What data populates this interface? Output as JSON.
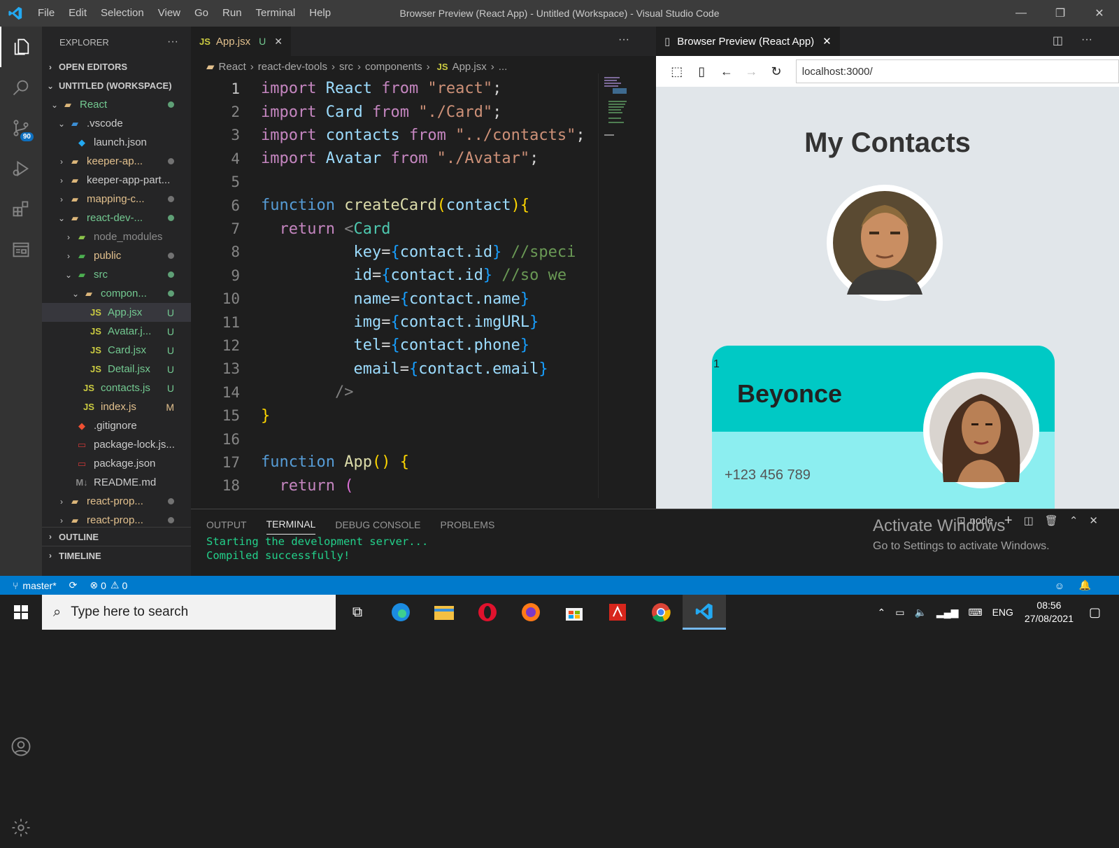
{
  "window": {
    "title": "Browser Preview (React App) - Untitled (Workspace) - Visual Studio Code",
    "menu": [
      "File",
      "Edit",
      "Selection",
      "View",
      "Go",
      "Run",
      "Terminal",
      "Help"
    ],
    "controls": {
      "minimize": "—",
      "restore": "❐",
      "close": "✕"
    }
  },
  "activity_bar": {
    "items": [
      "explorer-icon",
      "search-icon",
      "source-control-icon",
      "run-debug-icon",
      "extensions-icon",
      "browser-preview-icon"
    ],
    "source_control_badge": "90",
    "bottom": [
      "account-icon",
      "settings-gear-icon"
    ]
  },
  "sidebar": {
    "title": "EXPLORER",
    "more": "···",
    "sections": {
      "open_editors": "OPEN EDITORS",
      "workspace": "UNTITLED (WORKSPACE)",
      "outline": "OUTLINE",
      "timeline": "TIMELINE"
    },
    "tree": [
      {
        "label": "React",
        "indent": 1,
        "chev": "⌄",
        "icon": "folder",
        "color": "#73c991",
        "dot": "green"
      },
      {
        "label": ".vscode",
        "indent": 2,
        "chev": "⌄",
        "icon": "vscode-folder",
        "color": "#cccccc"
      },
      {
        "label": "launch.json",
        "indent": 3,
        "chev": "",
        "icon": "vscode-file",
        "color": "#cccccc"
      },
      {
        "label": "keeper-ap...",
        "indent": 2,
        "chev": "›",
        "icon": "folder",
        "color": "#e2c08d",
        "dot": "grey"
      },
      {
        "label": "keeper-app-part...",
        "indent": 2,
        "chev": "›",
        "icon": "folder",
        "color": "#cccccc"
      },
      {
        "label": "mapping-c...",
        "indent": 2,
        "chev": "›",
        "icon": "folder",
        "color": "#e2c08d",
        "dot": "grey"
      },
      {
        "label": "react-dev-...",
        "indent": 2,
        "chev": "⌄",
        "icon": "folder",
        "color": "#73c991",
        "dot": "green"
      },
      {
        "label": "node_modules",
        "indent": 3,
        "chev": "›",
        "icon": "node-folder",
        "color": "#8c8c8c"
      },
      {
        "label": "public",
        "indent": 3,
        "chev": "›",
        "icon": "public-folder",
        "color": "#e2c08d",
        "dot": "grey"
      },
      {
        "label": "src",
        "indent": 3,
        "chev": "⌄",
        "icon": "src-folder",
        "color": "#73c991",
        "dot": "green"
      },
      {
        "label": "compon...",
        "indent": 4,
        "chev": "⌄",
        "icon": "folder",
        "color": "#73c991",
        "dot": "green"
      },
      {
        "label": "App.jsx",
        "indent": 5,
        "chev": "",
        "icon": "js",
        "color": "#73c991",
        "mark": "U",
        "selected": true
      },
      {
        "label": "Avatar.j...",
        "indent": 5,
        "chev": "",
        "icon": "js",
        "color": "#73c991",
        "mark": "U"
      },
      {
        "label": "Card.jsx",
        "indent": 5,
        "chev": "",
        "icon": "js",
        "color": "#73c991",
        "mark": "U"
      },
      {
        "label": "Detail.jsx",
        "indent": 5,
        "chev": "",
        "icon": "js",
        "color": "#73c991",
        "mark": "U"
      },
      {
        "label": "contacts.js",
        "indent": 4,
        "chev": "",
        "icon": "js",
        "color": "#73c991",
        "mark": "U"
      },
      {
        "label": "index.js",
        "indent": 4,
        "chev": "",
        "icon": "js",
        "color": "#e2c08d",
        "mark": "M"
      },
      {
        "label": ".gitignore",
        "indent": 3,
        "chev": "",
        "icon": "git",
        "color": "#cccccc"
      },
      {
        "label": "package-lock.js...",
        "indent": 3,
        "chev": "",
        "icon": "npm",
        "color": "#cccccc"
      },
      {
        "label": "package.json",
        "indent": 3,
        "chev": "",
        "icon": "npm",
        "color": "#cccccc"
      },
      {
        "label": "README.md",
        "indent": 3,
        "chev": "",
        "icon": "md",
        "color": "#cccccc"
      },
      {
        "label": "react-prop...",
        "indent": 2,
        "chev": "›",
        "icon": "folder",
        "color": "#e2c08d",
        "dot": "grey"
      },
      {
        "label": "react-prop...",
        "indent": 2,
        "chev": "›",
        "icon": "folder",
        "color": "#e2c08d",
        "dot": "grey"
      }
    ]
  },
  "editor": {
    "tab": {
      "icon": "JS",
      "label": "App.jsx",
      "mark": "U",
      "close": "✕"
    },
    "more": "···",
    "breadcrumb": [
      "React",
      "react-dev-tools",
      "src",
      "components",
      "JS",
      "App.jsx",
      "..."
    ],
    "lines": [
      "1",
      "2",
      "3",
      "4",
      "5",
      "6",
      "7",
      "8",
      "9",
      "10",
      "11",
      "12",
      "13",
      "14",
      "15",
      "16",
      "17",
      "18"
    ],
    "code": {
      "l1": [
        "import",
        " React ",
        "from",
        " \"react\"",
        ";"
      ],
      "l2": [
        "import",
        " Card ",
        "from",
        " \"./Card\"",
        ";"
      ],
      "l3": [
        "import",
        " contacts ",
        "from",
        " \"../contacts\"",
        ";"
      ],
      "l4": [
        "import",
        " Avatar ",
        "from",
        " \"./Avatar\"",
        ";"
      ],
      "l6": [
        "function",
        " createCard",
        "(",
        "contact",
        "){"
      ],
      "l7": [
        "return",
        " <",
        "Card"
      ],
      "l8": [
        "key",
        "=",
        "{",
        "contact.id",
        "}",
        " //speci"
      ],
      "l9": [
        "id",
        "=",
        "{",
        "contact.id",
        "}",
        " //so we"
      ],
      "l10": [
        "name",
        "=",
        "{",
        "contact.name",
        "}"
      ],
      "l11": [
        "img",
        "=",
        "{",
        "contact.imgURL",
        "}"
      ],
      "l12": [
        "tel",
        "=",
        "{",
        "contact.phone",
        "}"
      ],
      "l13": [
        "email",
        "=",
        "{",
        "contact.email",
        "}"
      ],
      "l14": [
        "/>"
      ],
      "l15": [
        "}"
      ],
      "l17": [
        "function",
        " App",
        "()",
        " {"
      ],
      "l18": [
        "return",
        " ("
      ]
    }
  },
  "browser": {
    "tab_label": "Browser Preview (React App)",
    "tab_close": "✕",
    "url": "localhost:3000/",
    "page": {
      "heading": "My Contacts",
      "card_index": "1",
      "card_name": "Beyonce",
      "card_phone": "+123 456 789"
    }
  },
  "panel": {
    "tabs": [
      "OUTPUT",
      "TERMINAL",
      "DEBUG CONSOLE",
      "PROBLEMS"
    ],
    "active_tab": "TERMINAL",
    "terminal_name": "node",
    "terminal_lines": [
      "Starting the development server...",
      "Compiled successfully!"
    ],
    "watermark_title": "Activate Windows",
    "watermark_sub": "Go to Settings to activate Windows."
  },
  "status_bar": {
    "branch": "master*",
    "errors": "0",
    "warnings": "0"
  },
  "taskbar": {
    "search_placeholder": "Type here to search",
    "apps": [
      "task-view-icon",
      "edge-icon",
      "file-explorer-icon",
      "opera-icon",
      "firefox-icon",
      "store-icon",
      "acrobat-icon",
      "chrome-icon",
      "vscode-taskbar-icon"
    ],
    "lang": "ENG",
    "time": "08:56",
    "date": "27/08/2021"
  },
  "colors": {
    "accent": "#007acc",
    "card_teal": "#00c9c5",
    "card_light": "#8ceef0"
  }
}
